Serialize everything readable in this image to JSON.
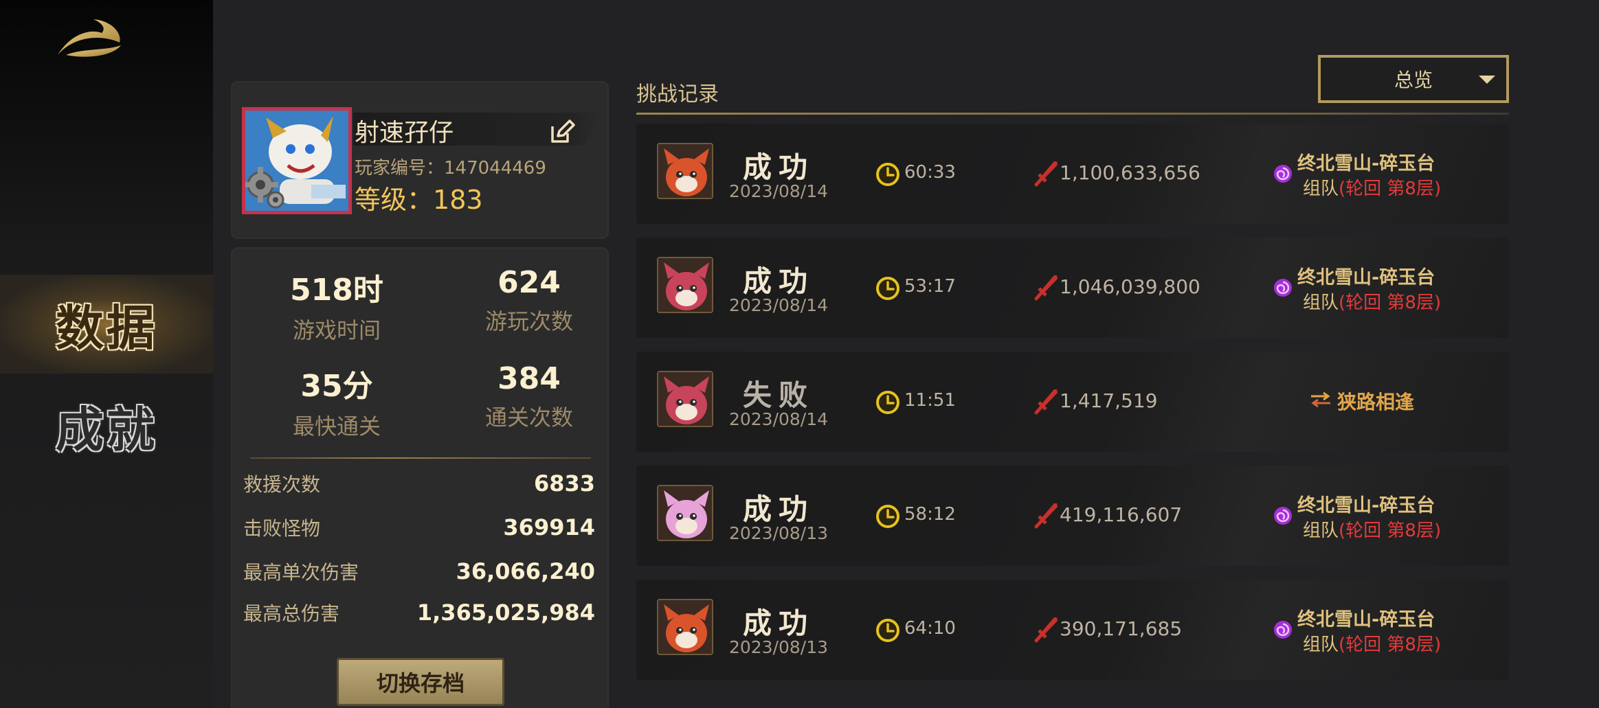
{
  "nav": {
    "items": [
      {
        "label": "数据",
        "active": true
      },
      {
        "label": "成就",
        "active": false
      }
    ]
  },
  "profile": {
    "name": "射速孖仔",
    "id_label": "玩家编号：",
    "id_value": "147044469",
    "level_label": "等级：",
    "level_value": "183"
  },
  "stats": {
    "big": [
      {
        "value": "518时",
        "label": "游戏时间"
      },
      {
        "value": "624",
        "label": "游玩次数"
      },
      {
        "value": "35分",
        "label": "最快通关"
      },
      {
        "value": "384",
        "label": "通关次数"
      }
    ],
    "rows": [
      {
        "label": "救援次数",
        "value": "6833"
      },
      {
        "label": "击败怪物",
        "value": "369914"
      },
      {
        "label": "最高单次伤害",
        "value": "36,066,240"
      },
      {
        "label": "最高总伤害",
        "value": "1,365,025,984"
      }
    ],
    "switch_button": "切换存档"
  },
  "records": {
    "title": "挑战记录",
    "filter": "总览",
    "items": [
      {
        "result": "成功",
        "date": "2023/08/14",
        "time": "60:33",
        "damage": "1,100,633,656",
        "loc1": "终北雪山-碎玉台",
        "team": "组队",
        "mode_detail": "(轮回 第8层)",
        "avatar_color": "#d9532b"
      },
      {
        "result": "成功",
        "date": "2023/08/14",
        "time": "53:17",
        "damage": "1,046,039,800",
        "loc1": "终北雪山-碎玉台",
        "team": "组队",
        "mode_detail": "(轮回 第8层)",
        "avatar_color": "#c8445a"
      },
      {
        "result": "失败",
        "date": "2023/08/14",
        "time": "11:51",
        "damage": "1,417,519",
        "mode": "狭路相逢",
        "avatar_color": "#c8445a"
      },
      {
        "result": "成功",
        "date": "2023/08/13",
        "time": "58:12",
        "damage": "419,116,607",
        "loc1": "终北雪山-碎玉台",
        "team": "组队",
        "mode_detail": "(轮回 第8层)",
        "avatar_color": "#e7a3d8"
      },
      {
        "result": "成功",
        "date": "2023/08/13",
        "time": "64:10",
        "damage": "390,171,685",
        "loc1": "终北雪山-碎玉台",
        "team": "组队",
        "mode_detail": "(轮回 第8层)",
        "avatar_color": "#d9532b"
      }
    ]
  },
  "icons": {
    "logo": "dragon-logo-icon",
    "edit": "edit-icon",
    "settings": "gear-icon",
    "clock": "clock-icon",
    "damage": "sword-icon",
    "portal": "portal-icon",
    "mode": "crossed-arrows-icon",
    "dropdown": "caret-down-icon"
  },
  "colors": {
    "gold": "#e0c27e",
    "level": "#f2c55a",
    "red": "#e53a3a",
    "portal": "#a42fd8"
  }
}
